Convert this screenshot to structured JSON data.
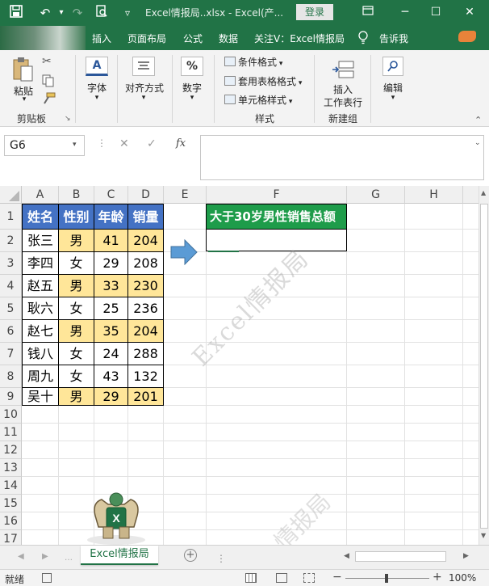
{
  "titlebar": {
    "title": "Excel情报局..xlsx  -  Excel(产...",
    "login_label": "登录",
    "save_icon": "save-icon",
    "undo_icon": "undo-icon",
    "redo_icon": "redo-icon",
    "preview_icon": "print-preview-icon",
    "customize_icon": "chevron-down-icon",
    "minimize_icon": "minimize-icon",
    "restore_icon": "restore-icon",
    "close_icon": "close-icon",
    "ribbon_display_icon": "ribbon-display-icon"
  },
  "tabs": [
    "插入",
    "页面布局",
    "公式",
    "数据",
    "关注V：Excel情报局",
    "告诉我"
  ],
  "tell_me_icon": "lightbulb-icon",
  "ribbon": {
    "paste_label": "粘贴",
    "clipboard_group": "剪贴板",
    "font_label": "字体",
    "align_label": "对齐方式",
    "number_label": "数字",
    "cond_format": "条件格式",
    "table_format": "套用表格格式",
    "cell_style": "单元格样式",
    "style_group": "样式",
    "insert_label": "插入",
    "insert_sub": "工作表行",
    "newgroup_label": "新建组",
    "edit_label": "编辑",
    "percent_symbol": "%",
    "font_symbol": "A"
  },
  "formula_bar": {
    "namebox": "G6",
    "fx": "fx",
    "cancel_icon": "cancel-icon",
    "confirm_icon": "check-icon",
    "formula": ""
  },
  "columns": [
    "A",
    "B",
    "C",
    "D",
    "E",
    "F",
    "G",
    "H"
  ],
  "rows": [
    "1",
    "2",
    "3",
    "4",
    "5",
    "6",
    "7",
    "8",
    "9",
    "10",
    "11",
    "12",
    "13",
    "14",
    "15",
    "16",
    "17"
  ],
  "table": {
    "headers": [
      "姓名",
      "性别",
      "年龄",
      "销量"
    ],
    "rows": [
      {
        "name": "张三",
        "gender": "男",
        "age": "41",
        "sales": "204",
        "highlight": true
      },
      {
        "name": "李四",
        "gender": "女",
        "age": "29",
        "sales": "208",
        "highlight": false
      },
      {
        "name": "赵五",
        "gender": "男",
        "age": "33",
        "sales": "230",
        "highlight": true
      },
      {
        "name": "耿六",
        "gender": "女",
        "age": "25",
        "sales": "236",
        "highlight": false
      },
      {
        "name": "赵七",
        "gender": "男",
        "age": "35",
        "sales": "204",
        "highlight": true
      },
      {
        "name": "钱八",
        "gender": "女",
        "age": "24",
        "sales": "288",
        "highlight": false
      },
      {
        "name": "周九",
        "gender": "女",
        "age": "43",
        "sales": "132",
        "highlight": false
      },
      {
        "name": "吴十",
        "gender": "男",
        "age": "29",
        "sales": "201",
        "highlight": true
      }
    ]
  },
  "result": {
    "header": "大于30岁男性销售总额",
    "value": ""
  },
  "watermark": "Excel情报局",
  "sheet_tab": "Excel情报局",
  "add_sheet_icon": "plus-circle-icon",
  "status": {
    "ready": "就绪",
    "zoom": "100%"
  },
  "colors": {
    "excel_green": "#217346",
    "header_blue": "#4472c4",
    "highlight_yellow": "#ffe699",
    "result_green": "#1e9c4a",
    "arrow_blue": "#5b9bd5"
  }
}
